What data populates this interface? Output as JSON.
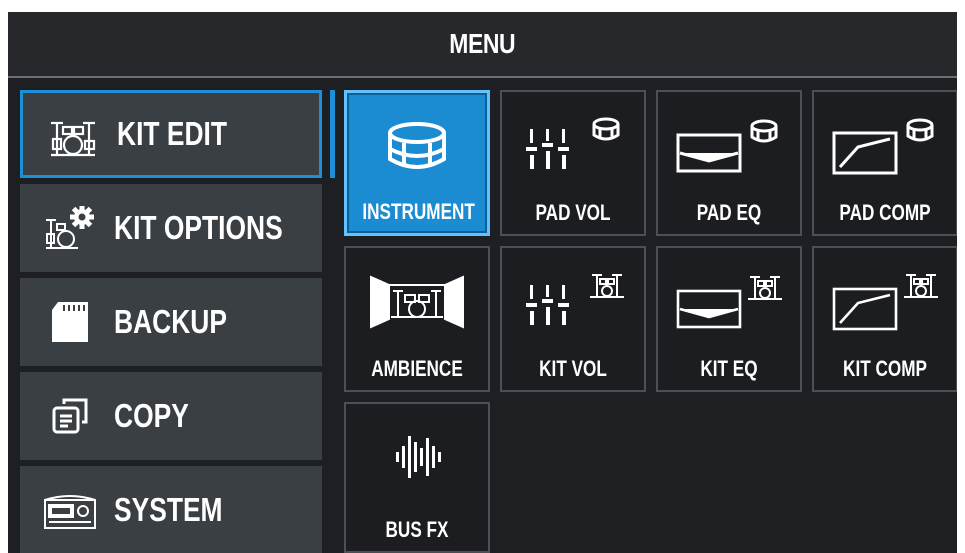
{
  "header": {
    "title": "MENU"
  },
  "sidebar": {
    "items": [
      {
        "label": "KIT EDIT",
        "icon": "drum-kit-icon",
        "active": true
      },
      {
        "label": "KIT OPTIONS",
        "icon": "drum-kit-gear-icon",
        "active": false
      },
      {
        "label": "BACKUP",
        "icon": "sd-card-icon",
        "active": false
      },
      {
        "label": "COPY",
        "icon": "copy-icon",
        "active": false
      },
      {
        "label": "SYSTEM",
        "icon": "module-device-icon",
        "active": false
      }
    ]
  },
  "grid": {
    "tiles": [
      {
        "label": "INSTRUMENT",
        "icon": "snare-drum-icon",
        "active": true
      },
      {
        "label": "PAD VOL",
        "icon": "faders-drum-icon",
        "active": false
      },
      {
        "label": "PAD EQ",
        "icon": "eq-curve-drum-icon",
        "active": false
      },
      {
        "label": "PAD COMP",
        "icon": "compressor-curve-drum-icon",
        "active": false
      },
      {
        "label": "AMBIENCE",
        "icon": "room-kit-icon",
        "active": false
      },
      {
        "label": "KIT VOL",
        "icon": "faders-kit-icon",
        "active": false
      },
      {
        "label": "KIT EQ",
        "icon": "eq-curve-kit-icon",
        "active": false
      },
      {
        "label": "KIT COMP",
        "icon": "compressor-curve-kit-icon",
        "active": false
      },
      {
        "label": "BUS FX",
        "icon": "waveform-icon",
        "active": false
      }
    ]
  },
  "colors": {
    "accent": "#1d8ed8",
    "background": "#1e1f22",
    "panel": "#3a3f44"
  }
}
